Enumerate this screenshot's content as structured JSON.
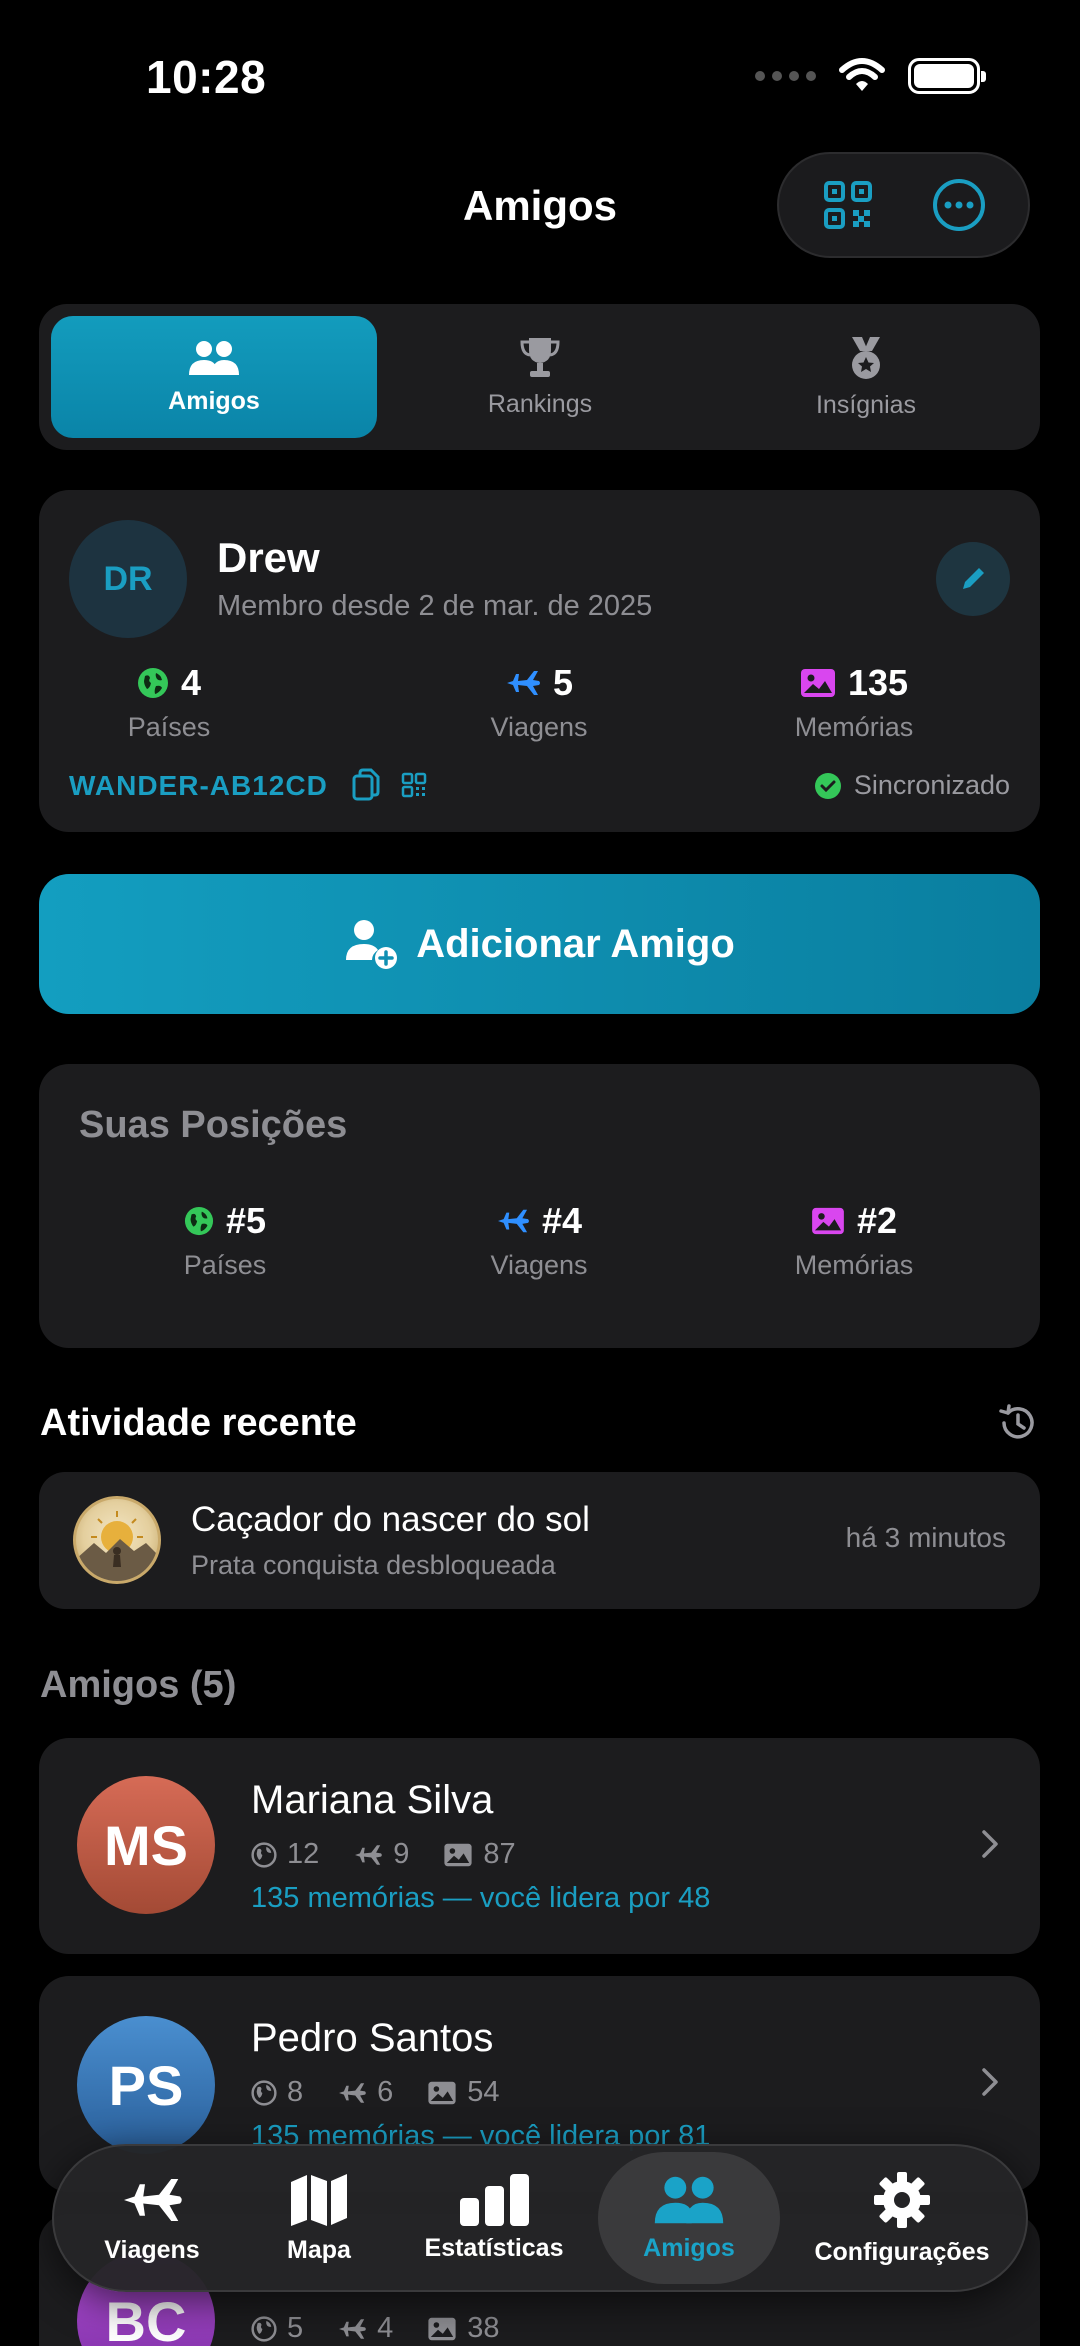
{
  "status_bar": {
    "time": "10:28"
  },
  "header": {
    "title": "Amigos"
  },
  "segments": [
    {
      "label": "Amigos",
      "active": true
    },
    {
      "label": "Rankings",
      "active": false
    },
    {
      "label": "Insígnias",
      "active": false
    }
  ],
  "profile": {
    "initials": "DR",
    "name": "Drew",
    "member_since": "Membro desde 2 de mar. de 2025",
    "stats": [
      {
        "value": "4",
        "label": "Países",
        "icon": "globe-icon"
      },
      {
        "value": "5",
        "label": "Viagens",
        "icon": "plane-icon"
      },
      {
        "value": "135",
        "label": "Memórias",
        "icon": "photo-icon"
      }
    ],
    "code": "WANDER-AB12CD",
    "sync_status": "Sincronizado"
  },
  "add_friend": {
    "label": "Adicionar Amigo"
  },
  "positions": {
    "title": "Suas Posições",
    "items": [
      {
        "value": "#5",
        "label": "Países",
        "icon": "globe-icon"
      },
      {
        "value": "#4",
        "label": "Viagens",
        "icon": "plane-icon"
      },
      {
        "value": "#2",
        "label": "Memórias",
        "icon": "photo-icon"
      }
    ]
  },
  "activity": {
    "title": "Atividade recente",
    "items": [
      {
        "title": "Caçador do nascer do sol",
        "subtitle": "Prata conquista desbloqueada",
        "time": "há 3 minutos"
      }
    ]
  },
  "friends": {
    "title": "Amigos (5)",
    "items": [
      {
        "initials": "MS",
        "name": "Mariana Silva",
        "countries": "12",
        "trips": "9",
        "memories": "87",
        "lead": "135 memórias — você lidera por 48"
      },
      {
        "initials": "PS",
        "name": "Pedro Santos",
        "countries": "8",
        "trips": "6",
        "memories": "54",
        "lead": "135 memórias — você lidera por 81"
      },
      {
        "initials": "BC",
        "name": "",
        "countries": "5",
        "trips": "4",
        "memories": "38",
        "lead": ""
      }
    ]
  },
  "tabbar": [
    {
      "label": "Viagens",
      "icon": "plane-icon",
      "active": false
    },
    {
      "label": "Mapa",
      "icon": "map-icon",
      "active": false
    },
    {
      "label": "Estatísticas",
      "icon": "bar-chart-icon",
      "active": false
    },
    {
      "label": "Amigos",
      "icon": "people-icon",
      "active": true
    },
    {
      "label": "Configurações",
      "icon": "gear-icon",
      "active": false
    }
  ],
  "colors": {
    "accent": "#1a9ec2",
    "background": "#000000",
    "card": "#1c1c1e",
    "globe": "#34c759",
    "plane": "#2f8fff",
    "photo": "#d946ef"
  }
}
